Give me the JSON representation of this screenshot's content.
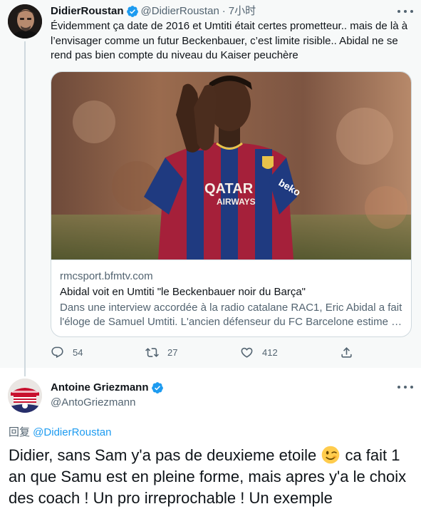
{
  "parent_tweet": {
    "display_name": "DidierRoustan",
    "handle": "@DidierRoustan",
    "time": "7小时",
    "text": "Évidemment ça date de 2016 et Umtiti était certes prometteur.. mais de là à l’envisager comme un futur Beckenbauer, c’est limite risible.. Abidal ne se rend pas bien compte du niveau du Kaiser peuchère",
    "card": {
      "domain": "rmcsport.bfmtv.com",
      "title": "Abidal voit en Umtiti \"le Beckenbauer noir du Barça\"",
      "description": "Dans une interview accordée à la radio catalane RAC1, Eric Abidal a fait l'éloge de Samuel Umtiti. L'ancien défenseur du FC Barcelone estime …",
      "image_text": {
        "sponsor": "QATAR\nAIRWAYS",
        "beko": "beko"
      }
    },
    "actions": {
      "replies": "54",
      "retweets": "27",
      "likes": "412"
    }
  },
  "reply_tweet": {
    "display_name": "Antoine Griezmann",
    "handle": "@AntoGriezmann",
    "replying_prefix": "回复 ",
    "replying_to": "@DidierRoustan",
    "text_part1": "Didier, sans Sam y'a pas de deuxieme etoile ",
    "emoji": "winking-face",
    "text_part2": " ca fait 1 an que Samu est en pleine forme, mais apres y'a le choix des coach ! Un pro irreprochable ! Un exemple"
  },
  "colors": {
    "verified_blue": "#1d9bf0",
    "secondary_text": "#536471",
    "link_blue": "#1d9bf0",
    "parent_background": "#f7f9f9"
  }
}
